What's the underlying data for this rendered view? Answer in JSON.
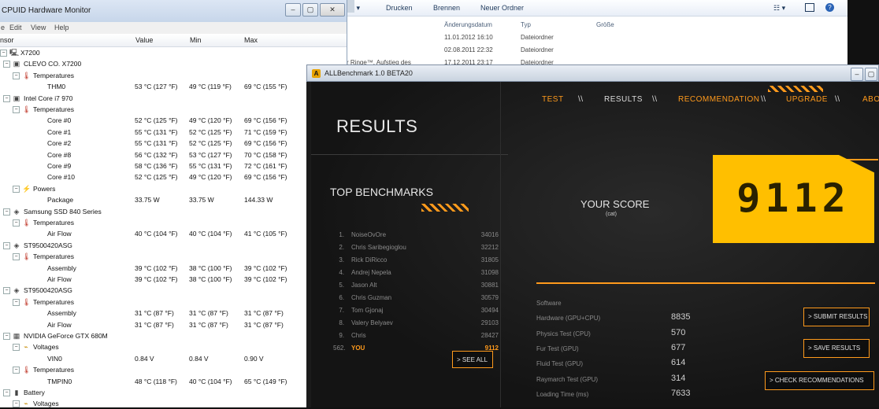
{
  "explorer": {
    "toolbar": {
      "item1": "ür ▾",
      "drucken": "Drucken",
      "brennen": "Brennen",
      "neuer_ordner": "Neuer Ordner",
      "view_icons": "☷ ▾"
    },
    "headers": {
      "date": "Änderungsdatum",
      "type": "Typ",
      "size": "Größe"
    },
    "rows": [
      {
        "name": "",
        "date": "11.01.2012 16:10",
        "type": "Dateiordner"
      },
      {
        "name": "",
        "date": "02.08.2011 22:32",
        "type": "Dateiordner"
      },
      {
        "name": "r Ringe™, Aufstieg des",
        "date": "17.12.2011 23:17",
        "type": "Dateiordner"
      }
    ]
  },
  "hwmonitor": {
    "title": "CPUID Hardware Monitor",
    "menu": [
      "e",
      "Edit",
      "View",
      "Help"
    ],
    "columns": {
      "sensor": "nsor",
      "value": "Value",
      "min": "Min",
      "max": "Max"
    },
    "tree": [
      {
        "level": 0,
        "exp": "−",
        "icon": "computer-icon",
        "glyph": "🖳",
        "label": "X7200"
      },
      {
        "level": 1,
        "exp": "−",
        "icon": "mainboard-icon",
        "glyph": "▣",
        "label": "CLEVO CO. X7200"
      },
      {
        "level": 2,
        "exp": "−",
        "icon": "thermometer-icon",
        "glyph": "🌡",
        "label": "Temperatures"
      },
      {
        "level": 3,
        "label": "THM0",
        "value": "53 °C  (127 °F)",
        "min": "49 °C  (119 °F)",
        "max": "69 °C  (155 °F)"
      },
      {
        "level": 1,
        "exp": "−",
        "icon": "cpu-icon",
        "glyph": "▣",
        "label": "Intel Core i7 970"
      },
      {
        "level": 2,
        "exp": "−",
        "icon": "thermometer-icon",
        "glyph": "🌡",
        "label": "Temperatures"
      },
      {
        "level": 3,
        "label": "Core #0",
        "value": "52 °C  (125 °F)",
        "min": "49 °C  (120 °F)",
        "max": "69 °C  (156 °F)"
      },
      {
        "level": 3,
        "label": "Core #1",
        "value": "55 °C  (131 °F)",
        "min": "52 °C  (125 °F)",
        "max": "71 °C  (159 °F)"
      },
      {
        "level": 3,
        "label": "Core #2",
        "value": "55 °C  (131 °F)",
        "min": "52 °C  (125 °F)",
        "max": "69 °C  (156 °F)"
      },
      {
        "level": 3,
        "label": "Core #8",
        "value": "56 °C  (132 °F)",
        "min": "53 °C  (127 °F)",
        "max": "70 °C  (158 °F)"
      },
      {
        "level": 3,
        "label": "Core #9",
        "value": "58 °C  (136 °F)",
        "min": "55 °C  (131 °F)",
        "max": "72 °C  (161 °F)"
      },
      {
        "level": 3,
        "label": "Core #10",
        "value": "52 °C  (125 °F)",
        "min": "49 °C  (120 °F)",
        "max": "69 °C  (156 °F)"
      },
      {
        "level": 2,
        "exp": "−",
        "icon": "power-icon",
        "glyph": "⚡",
        "label": "Powers"
      },
      {
        "level": 3,
        "label": "Package",
        "value": "33.75 W",
        "min": "33.75 W",
        "max": "144.33 W"
      },
      {
        "level": 1,
        "exp": "−",
        "icon": "disk-icon",
        "glyph": "◈",
        "label": "Samsung SSD 840 Series"
      },
      {
        "level": 2,
        "exp": "−",
        "icon": "thermometer-icon",
        "glyph": "🌡",
        "label": "Temperatures"
      },
      {
        "level": 3,
        "label": "Air Flow",
        "value": "40 °C  (104 °F)",
        "min": "40 °C  (104 °F)",
        "max": "41 °C  (105 °F)"
      },
      {
        "level": 1,
        "exp": "−",
        "icon": "disk-icon",
        "glyph": "◈",
        "label": "ST9500420ASG"
      },
      {
        "level": 2,
        "exp": "−",
        "icon": "thermometer-icon",
        "glyph": "🌡",
        "label": "Temperatures"
      },
      {
        "level": 3,
        "label": "Assembly",
        "value": "39 °C  (102 °F)",
        "min": "38 °C  (100 °F)",
        "max": "39 °C  (102 °F)"
      },
      {
        "level": 3,
        "label": "Air Flow",
        "value": "39 °C  (102 °F)",
        "min": "38 °C  (100 °F)",
        "max": "39 °C  (102 °F)"
      },
      {
        "level": 1,
        "exp": "−",
        "icon": "disk-icon",
        "glyph": "◈",
        "label": "ST9500420ASG"
      },
      {
        "level": 2,
        "exp": "−",
        "icon": "thermometer-icon",
        "glyph": "🌡",
        "label": "Temperatures"
      },
      {
        "level": 3,
        "label": "Assembly",
        "value": "31 °C  (87 °F)",
        "min": "31 °C  (87 °F)",
        "max": "31 °C  (87 °F)"
      },
      {
        "level": 3,
        "label": "Air Flow",
        "value": "31 °C  (87 °F)",
        "min": "31 °C  (87 °F)",
        "max": "31 °C  (87 °F)"
      },
      {
        "level": 1,
        "exp": "−",
        "icon": "gpu-icon",
        "glyph": "▦",
        "label": "NVIDIA GeForce GTX 680M"
      },
      {
        "level": 2,
        "exp": "−",
        "icon": "voltage-icon",
        "glyph": "⌁",
        "label": "Voltages"
      },
      {
        "level": 3,
        "label": "VIN0",
        "value": "0.84 V",
        "min": "0.84 V",
        "max": "0.90 V"
      },
      {
        "level": 2,
        "exp": "−",
        "icon": "thermometer-icon",
        "glyph": "🌡",
        "label": "Temperatures"
      },
      {
        "level": 3,
        "label": "TMPIN0",
        "value": "48 °C  (118 °F)",
        "min": "40 °C  (104 °F)",
        "max": "65 °C  (149 °F)"
      },
      {
        "level": 1,
        "exp": "−",
        "icon": "battery-icon",
        "glyph": "▮",
        "label": "Battery"
      },
      {
        "level": 2,
        "exp": "−",
        "icon": "voltage-icon",
        "glyph": "⌁",
        "label": "Voltages"
      }
    ]
  },
  "allbenchmark": {
    "title": "ALLBenchmark 1.0 BETA20",
    "nav": [
      "TEST",
      "\\\\",
      "RESULTS",
      "\\\\",
      "RECOMMENDATION",
      "\\\\",
      "UPGRADE",
      "\\\\",
      "ABOU"
    ],
    "results_title": "RESULTS",
    "top_benchmarks_title": "TOP BENCHMARKS",
    "benchmarks": [
      {
        "rank": "1.",
        "name": "NoiseOvOre",
        "score": "34016"
      },
      {
        "rank": "2.",
        "name": "Chris Saribegioglou",
        "score": "32212"
      },
      {
        "rank": "3.",
        "name": "Rick DiRicco",
        "score": "31805"
      },
      {
        "rank": "4.",
        "name": "Andrej Nepela",
        "score": "31098"
      },
      {
        "rank": "5.",
        "name": "Jason Alt",
        "score": "30881"
      },
      {
        "rank": "6.",
        "name": "Chris Guzman",
        "score": "30579"
      },
      {
        "rank": "7.",
        "name": "Tom Gjonaj",
        "score": "30494"
      },
      {
        "rank": "8.",
        "name": "Valery Belyaev",
        "score": "29103"
      },
      {
        "rank": "9.",
        "name": "Chris",
        "score": "28427"
      },
      {
        "rank": "562.",
        "name": "YOU",
        "score": "9112",
        "you": true
      }
    ],
    "see_all": "> SEE ALL",
    "your_score_label": "YOUR SCORE",
    "your_score_sub": "(cat)",
    "score": "9112",
    "metrics": [
      {
        "label": "Software",
        "value": ""
      },
      {
        "label": "Hardware (GPU+CPU)",
        "value": "8835"
      },
      {
        "label": "Physics Test (CPU)",
        "value": "570"
      },
      {
        "label": "Fur Test (GPU)",
        "value": "677"
      },
      {
        "label": "Fluid Test (GPU)",
        "value": "614"
      },
      {
        "label": "Raymarch Test (GPU)",
        "value": "314"
      },
      {
        "label": "Loading Time (ms)",
        "value": "7633"
      }
    ],
    "buttons": {
      "submit": "> SUBMIT RESULTS",
      "save": "> SAVE RESULTS",
      "check": "> CHECK RECOMMENDATIONS"
    },
    "colors": {
      "accent": "#ff9a1c",
      "score_bg": "#ffbf00"
    }
  }
}
